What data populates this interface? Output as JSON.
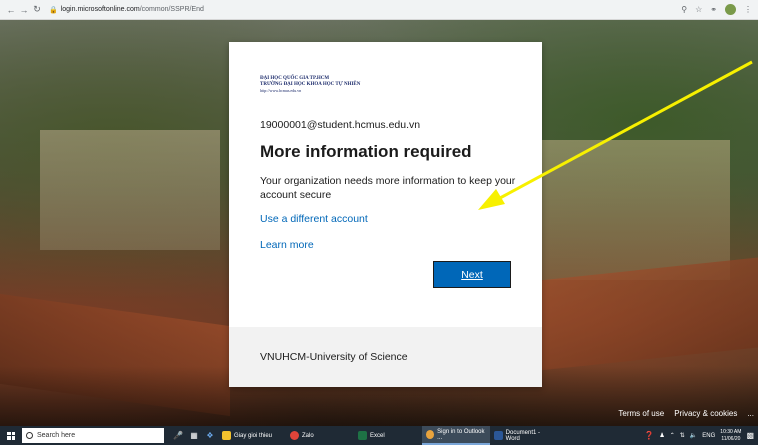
{
  "browser": {
    "url_host": "login.microsoftonline.com",
    "url_path": "/common/SSPR/End",
    "back_icon": "arrow-left-icon",
    "forward_icon": "arrow-right-icon",
    "reload_icon": "reload-icon",
    "lock_icon": "lock-icon"
  },
  "card": {
    "logo": {
      "line1": "ĐẠI HỌC QUỐC GIA TP.HCM",
      "line2": "TRƯỜNG ĐẠI HỌC KHOA HỌC TỰ NHIÊN",
      "line3": "http://www.hcmus.edu.vn"
    },
    "identity": "19000001@student.hcmus.edu.vn",
    "title": "More information required",
    "description": "Your organization needs more information to keep your account secure",
    "use_different_account": "Use a different account",
    "learn_more": "Learn more",
    "next_label": "Next",
    "footer_text": "VNUHCM-University of Science",
    "accent_color": "#0067b8"
  },
  "legal": {
    "terms": "Terms of use",
    "privacy": "Privacy & cookies",
    "more": "..."
  },
  "taskbar": {
    "search_placeholder": "Search here",
    "apps": [
      {
        "label": "Giay gioi thieu",
        "color": "#f2c12e"
      },
      {
        "label": "Zalo",
        "color": "#e0443a"
      },
      {
        "label": "Excel",
        "color": "#1e7145"
      },
      {
        "label": "Sign in to Outlook ...",
        "color": "#e8a33d"
      },
      {
        "label": "Document1 - Word",
        "color": "#2b5797"
      }
    ],
    "lang": "ENG",
    "time": "10:30 AM",
    "date": "11/06/20"
  },
  "annotation": {
    "arrow_color": "#f7f000"
  }
}
